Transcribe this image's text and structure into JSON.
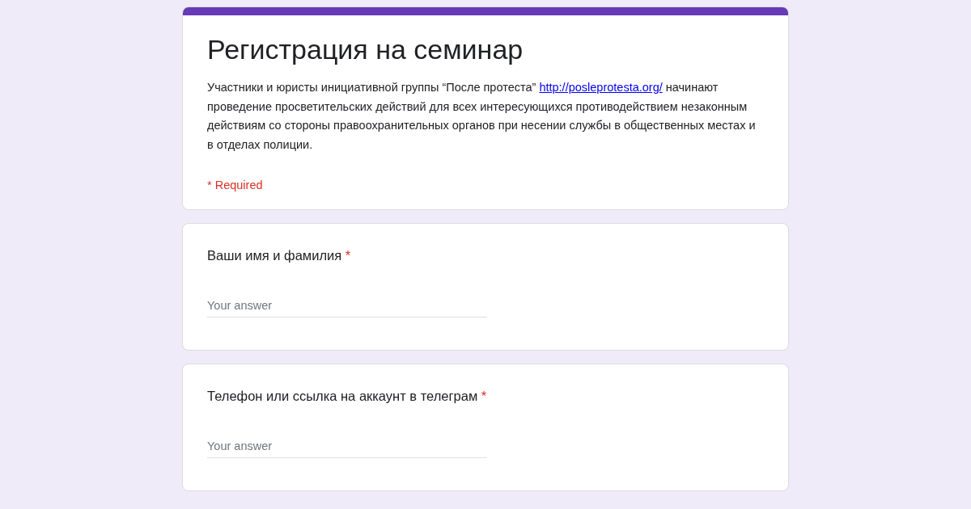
{
  "form": {
    "title": "Регистрация на семинар",
    "description": {
      "before": "Участники и юристы инициативной группы “После протеста”",
      "link": "http://posleprotesta.org/",
      "after": "начинают проведение просветительских действий для всех интересующихся противодействием незаконным действиям со стороны правоохранительных органов при несении службы в общественных местах и в отделах полиции."
    },
    "required_note": "* Required"
  },
  "questions": [
    {
      "title": "Ваши имя и фамилия",
      "required_mark": "*",
      "placeholder": "Your answer"
    },
    {
      "title": "Телефон или ссылка на аккаунт в телеграм",
      "required_mark": "*",
      "placeholder": "Your answer"
    }
  ]
}
